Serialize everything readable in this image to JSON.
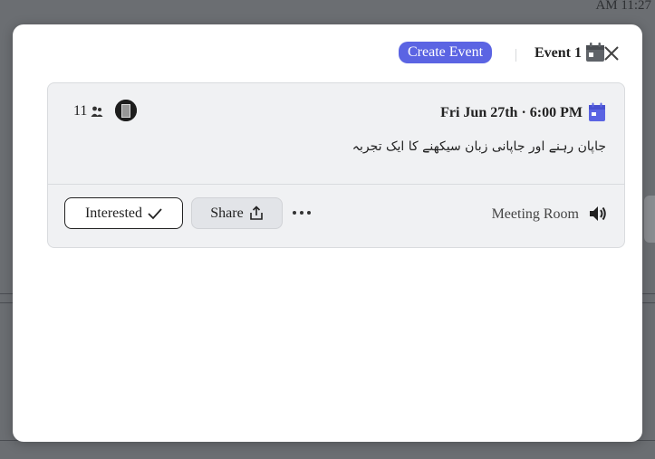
{
  "background": {
    "time_text": "AM 11:27"
  },
  "modal": {
    "create_button_label": "Create Event",
    "title": "Event 1"
  },
  "event": {
    "attendee_count": "11",
    "date_time": "Fri Jun 27th · 6:00 PM",
    "description": "جاپان رہنے اور جاپانی زبان سیکھنے کا ایک تجربہ",
    "interested_label": "Interested",
    "share_label": "Share",
    "location": "Meeting Room"
  },
  "colors": {
    "accent": "#5b64e3",
    "card_bg": "#f0f1f3",
    "overlay": "#6b6e72"
  },
  "icons": [
    "calendar-icon",
    "close-icon",
    "people-icon",
    "avatar",
    "check-icon",
    "share-icon",
    "more-icon",
    "speaker-icon"
  ]
}
